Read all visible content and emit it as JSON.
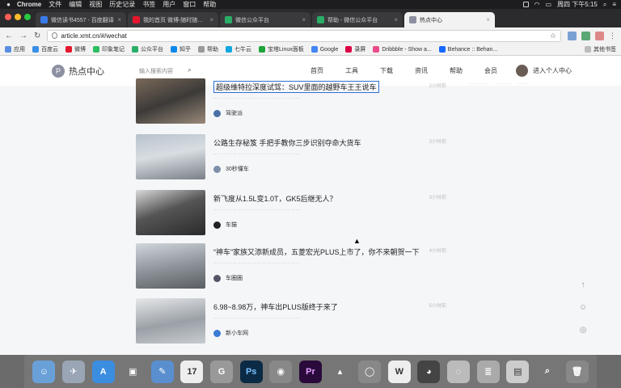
{
  "menubar": {
    "app": "Chrome",
    "items": [
      "文件",
      "编辑",
      "视图",
      "历史记录",
      "书签",
      "用户",
      "窗口",
      "帮助"
    ],
    "clock": "周四 下午5:15"
  },
  "tabs": [
    {
      "label": "微信读书4557 - 百度翻译",
      "active": false
    },
    {
      "label": "我的首页 微博-随时随地发现新鲜事",
      "active": false
    },
    {
      "label": "微信公众平台",
      "active": false
    },
    {
      "label": "帮助 - 微信公众平台",
      "active": false
    },
    {
      "label": "热点中心",
      "active": true
    }
  ],
  "address": {
    "url": "article.xmt.cn/#/wechat"
  },
  "bookmarks": [
    "应用",
    "百度云",
    "微博",
    "印象笔记",
    "公众平台",
    "知乎",
    "帮助",
    "七牛云",
    "宝塔Linux面板",
    "Google",
    "录屏",
    "Dribbble - Show a...",
    "Behance :: Behan...",
    "其他书签"
  ],
  "site": {
    "logo_letter": "P",
    "name": "热点中心",
    "search_placeholder": "输入搜索内容",
    "nav": [
      "首页",
      "工具",
      "下载",
      "资讯",
      "帮助",
      "会员"
    ],
    "user_label": "进入个人中心"
  },
  "feed": [
    {
      "title": "超级维特拉深度试驾：SUV里面的越野车王王说车",
      "source": "驾驶派",
      "summary": "………………………………………………",
      "time": "2小时前"
    },
    {
      "title": "公路生存秘笈 手把手教你三步识别夺命大货车",
      "source": "30秒懂车",
      "summary": "………………………………………………",
      "time": "3小时前"
    },
    {
      "title": "新飞度从1.5L变1.0T，GK5后继无人？",
      "source": "车猫",
      "summary": "………………………………………………",
      "time": "3小时前"
    },
    {
      "title": "“神车”家族又添新成员，五菱宏光PLUS上市了，你不来朝贺一下",
      "source": "车圈圈",
      "summary": "………………………………………………",
      "time": "4小时前"
    },
    {
      "title": "6.98~8.98万，神车出PLUS版终于来了",
      "source": "新小车网",
      "summary": "………………………………………………",
      "time": "5小时前"
    }
  ],
  "colors": {
    "menubar": "#1d1d1f",
    "page_bg": "#f5f6f8",
    "accent": "#2b6fd6"
  }
}
